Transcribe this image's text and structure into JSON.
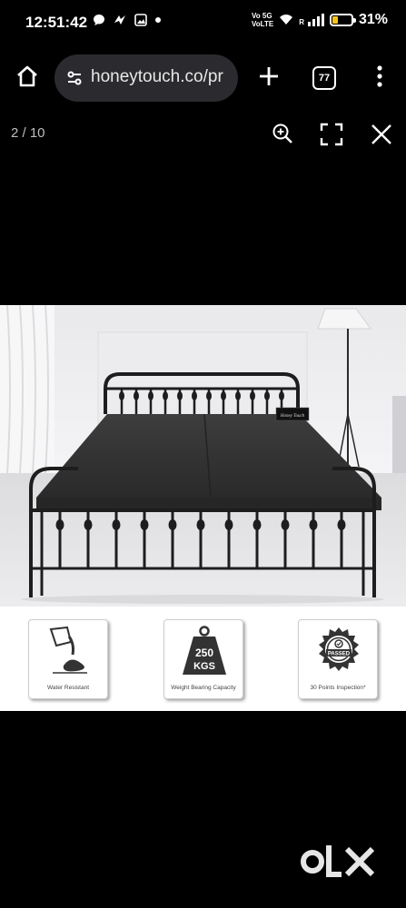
{
  "status_bar": {
    "time": "12:51:42",
    "network_top": "Vo 5G",
    "network_bottom": "VoLTE",
    "roaming": "R",
    "battery_percent": "31%",
    "battery_level": 0.31,
    "icons": [
      "chat-bubble-icon",
      "nfc-icon",
      "gallery-icon",
      "dot-icon",
      "wifi-icon",
      "signal-icon",
      "battery-icon"
    ]
  },
  "browser": {
    "url": "honeytouch.co/pr",
    "tab_count": "77",
    "icons": [
      "home-icon",
      "site-info-icon",
      "plus-icon",
      "tabs-icon",
      "menu-dots-icon"
    ]
  },
  "viewer": {
    "counter": "2 / 10",
    "icons": [
      "zoom-in-icon",
      "fullscreen-icon",
      "close-icon"
    ]
  },
  "product_image": {
    "brand_tag": "Honey Touch",
    "features": [
      {
        "label": "Water Resistant",
        "icon": "water-pour-icon"
      },
      {
        "label": "Weight Bearing Capacity",
        "icon": "weight-icon",
        "weight_value": "250",
        "weight_unit": "KGS"
      },
      {
        "label": "30 Points Inspection*",
        "icon": "passed-seal-icon",
        "seal_text": "PASSED"
      }
    ]
  },
  "watermark": {
    "logo": "olx",
    "icon": "olx-logo-icon"
  }
}
